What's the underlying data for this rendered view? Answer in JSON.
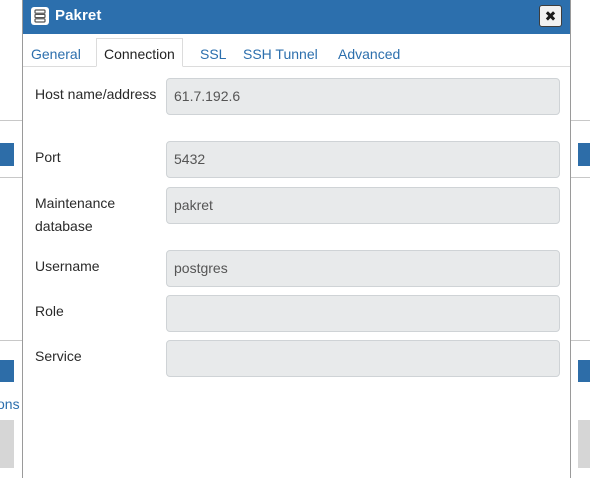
{
  "background": {
    "partial_link_text": "ons"
  },
  "dialog": {
    "title": "Pakret",
    "close_glyph": "✖",
    "tabs": [
      {
        "label": "General",
        "active": false
      },
      {
        "label": "Connection",
        "active": true
      },
      {
        "label": "SSL",
        "active": false
      },
      {
        "label": "SSH Tunnel",
        "active": false
      },
      {
        "label": "Advanced",
        "active": false
      }
    ],
    "fields": {
      "host": {
        "label": "Host name/address",
        "value": "61.7.192.6"
      },
      "port": {
        "label": "Port",
        "value": "5432"
      },
      "maintenance_db": {
        "label": "Maintenance database",
        "value": "pakret"
      },
      "username": {
        "label": "Username",
        "value": "postgres"
      },
      "role": {
        "label": "Role",
        "value": ""
      },
      "service": {
        "label": "Service",
        "value": ""
      }
    }
  },
  "colors": {
    "accent": "#2c6fad",
    "input_bg": "#e8eaeb"
  }
}
